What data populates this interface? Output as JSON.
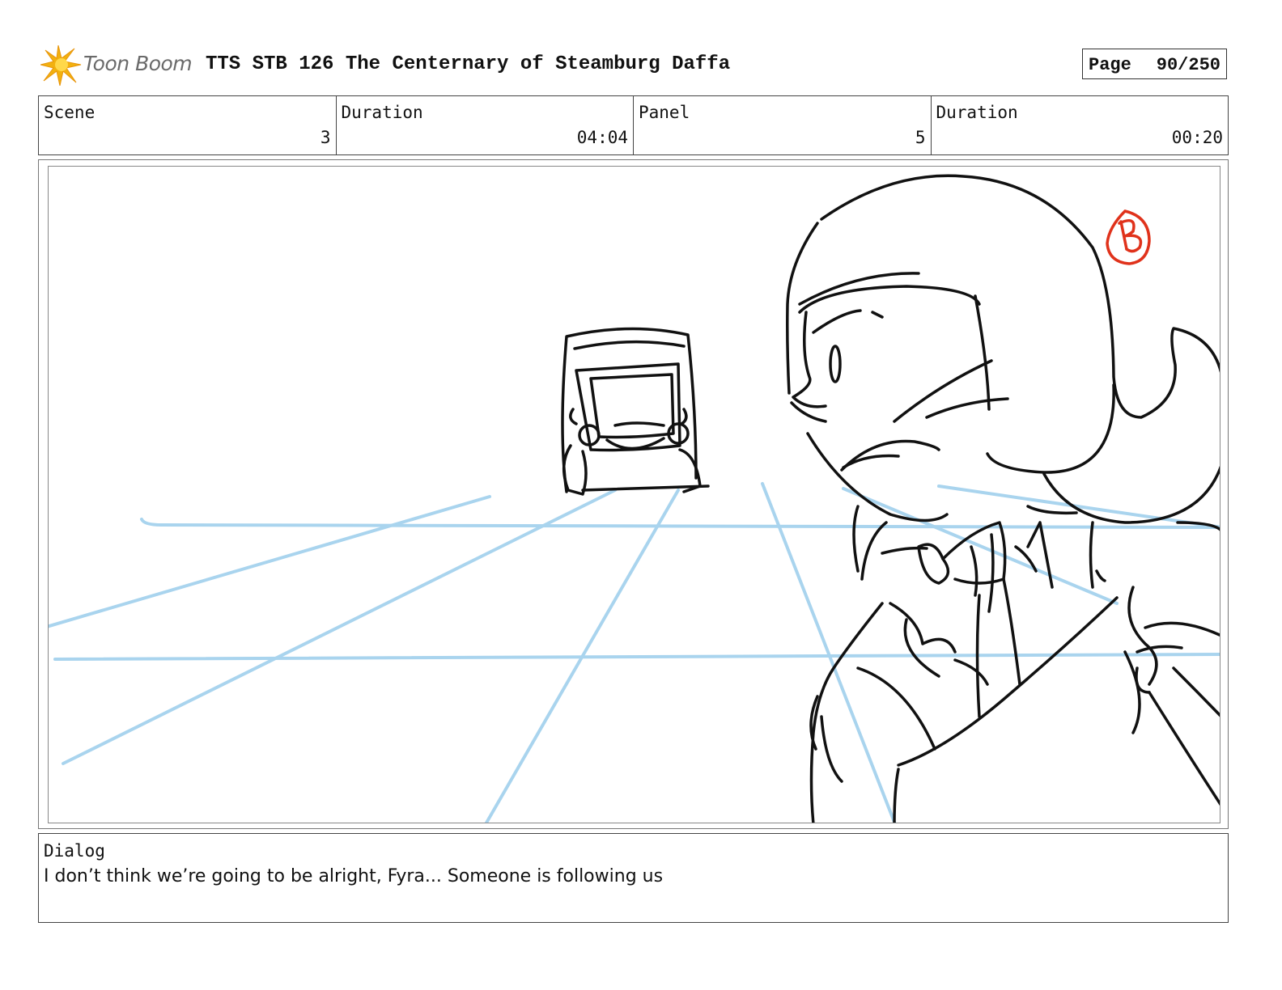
{
  "header": {
    "logo_text": "Toon Boom",
    "title": "TTS STB 126 The Centernary of Steamburg Daffa",
    "page_label": "Page",
    "page_value": "90/250"
  },
  "info": {
    "scene_label": "Scene",
    "scene_value": "3",
    "scene_duration_label": "Duration",
    "scene_duration_value": "04:04",
    "panel_label": "Panel",
    "panel_value": "5",
    "panel_duration_label": "Duration",
    "panel_duration_value": "00:20"
  },
  "dialog": {
    "label": "Dialog",
    "text": "I don’t think we’re going to be alright, Fyra... Someone is following us"
  },
  "colors": {
    "guide_lines": "#a9d4ee",
    "sketch": "#111111",
    "mark": "#e0321b",
    "logo_star": "#f2b10f"
  }
}
